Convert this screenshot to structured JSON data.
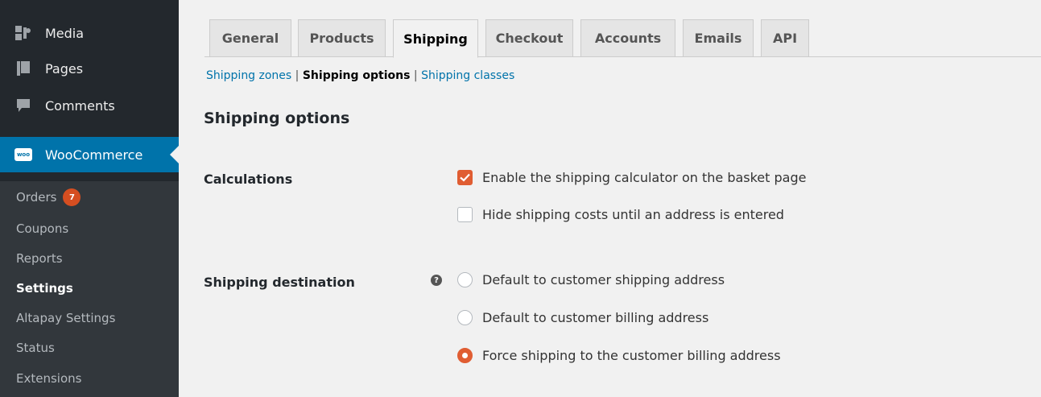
{
  "sidebar": {
    "menu": [
      {
        "label": "Media",
        "icon": "media-icon"
      },
      {
        "label": "Pages",
        "icon": "pages-icon"
      },
      {
        "label": "Comments",
        "icon": "comments-icon"
      },
      {
        "label": "WooCommerce",
        "icon": "woocommerce-icon",
        "logo_text": "woo"
      }
    ],
    "submenu": [
      {
        "label": "Orders",
        "badge": "7"
      },
      {
        "label": "Coupons"
      },
      {
        "label": "Reports"
      },
      {
        "label": "Settings",
        "current": true
      },
      {
        "label": "Altapay Settings"
      },
      {
        "label": "Status"
      },
      {
        "label": "Extensions"
      }
    ]
  },
  "tabs": [
    {
      "label": "General"
    },
    {
      "label": "Products"
    },
    {
      "label": "Shipping",
      "active": true
    },
    {
      "label": "Checkout"
    },
    {
      "label": "Accounts"
    },
    {
      "label": "Emails"
    },
    {
      "label": "API"
    }
  ],
  "subnav": {
    "zones": "Shipping zones",
    "sep1": "|",
    "options": "Shipping options",
    "sep2": "|",
    "classes": "Shipping classes"
  },
  "page_title": "Shipping options",
  "calculations": {
    "label": "Calculations",
    "options": [
      {
        "label": "Enable the shipping calculator on the basket page",
        "checked": true
      },
      {
        "label": "Hide shipping costs until an address is entered",
        "checked": false
      }
    ]
  },
  "destination": {
    "label": "Shipping destination",
    "help": "?",
    "options": [
      {
        "label": "Default to customer shipping address",
        "checked": false
      },
      {
        "label": "Default to customer billing address",
        "checked": false
      },
      {
        "label": "Force shipping to the customer billing address",
        "checked": true
      }
    ]
  },
  "colors": {
    "sidebar_bg": "#23282d",
    "submenu_bg": "#32373c",
    "active_blue": "#0073aa",
    "accent_orange": "#e05d32",
    "badge_orange": "#d54e21"
  }
}
